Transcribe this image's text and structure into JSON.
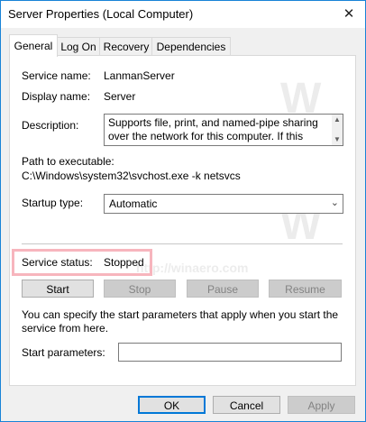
{
  "window": {
    "title": "Server Properties (Local Computer)",
    "close_glyph": "✕"
  },
  "tabs": [
    {
      "label": "General",
      "active": true
    },
    {
      "label": "Log On",
      "active": false
    },
    {
      "label": "Recovery",
      "active": false
    },
    {
      "label": "Dependencies",
      "active": false
    }
  ],
  "general": {
    "service_name_label": "Service name:",
    "service_name_value": "LanmanServer",
    "display_name_label": "Display name:",
    "display_name_value": "Server",
    "description_label": "Description:",
    "description_value": "Supports file, print, and named-pipe sharing over the network for this computer. If this service is stopped,",
    "path_label": "Path to executable:",
    "path_value": "C:\\Windows\\system32\\svchost.exe -k netsvcs",
    "startup_type_label": "Startup type:",
    "startup_type_value": "Automatic",
    "service_status_label": "Service status:",
    "service_status_value": "Stopped",
    "buttons": {
      "start": "Start",
      "stop": "Stop",
      "pause": "Pause",
      "resume": "Resume"
    },
    "help_text": "You can specify the start parameters that apply when you start the service from here.",
    "start_params_label": "Start parameters:",
    "start_params_value": ""
  },
  "footer": {
    "ok": "OK",
    "cancel": "Cancel",
    "apply": "Apply"
  },
  "watermark": {
    "text": "http://winaero.com",
    "logo": "W"
  },
  "colors": {
    "accent": "#0078d7",
    "highlight": "#f7b5bd",
    "disabled_bg": "#cccccc"
  }
}
